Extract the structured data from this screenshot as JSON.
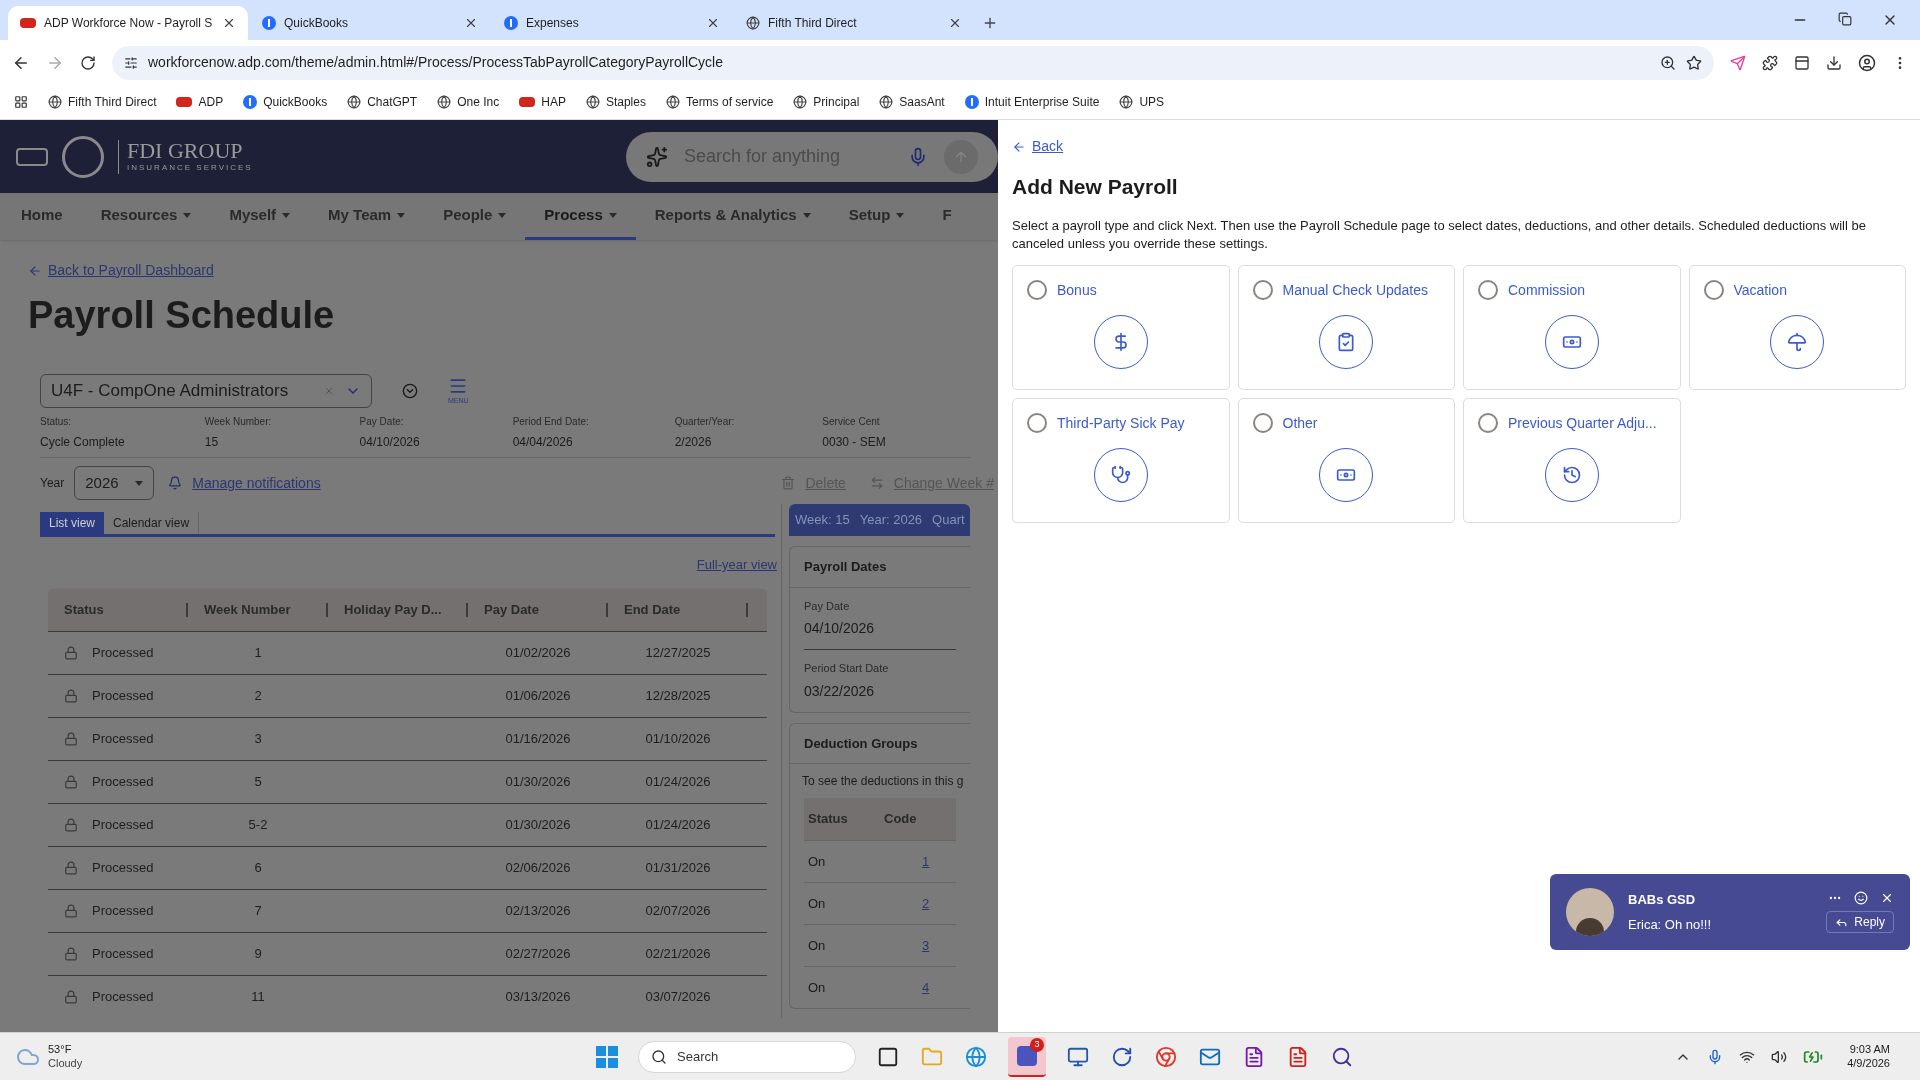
{
  "browser": {
    "tabs": [
      {
        "title": "ADP Workforce Now - Payroll S",
        "selected": true,
        "kind": "adp"
      },
      {
        "title": "QuickBooks",
        "selected": false,
        "kind": "intuit"
      },
      {
        "title": "Expenses",
        "selected": false,
        "kind": "intuit"
      },
      {
        "title": "Fifth Third Direct",
        "selected": false,
        "kind": "globe"
      }
    ],
    "url": "workforcenow.adp.com/theme/admin.html#/Process/ProcessTabPayrollCategoryPayrollCycle",
    "bookmarks": [
      {
        "label": "Fifth Third Direct",
        "kind": "globe"
      },
      {
        "label": "ADP",
        "kind": "adp"
      },
      {
        "label": "QuickBooks",
        "kind": "intuit"
      },
      {
        "label": "ChatGPT",
        "kind": "globe"
      },
      {
        "label": "One Inc",
        "kind": "globe"
      },
      {
        "label": "HAP",
        "kind": "adp"
      },
      {
        "label": "Staples",
        "kind": "globe"
      },
      {
        "label": "Terms of service",
        "kind": "globe"
      },
      {
        "label": "Principal",
        "kind": "globe"
      },
      {
        "label": "SaasAnt",
        "kind": "globe"
      },
      {
        "label": "Intuit Enterprise Suite",
        "kind": "intuit"
      },
      {
        "label": "UPS",
        "kind": "globe"
      }
    ]
  },
  "app": {
    "brand": {
      "name": "FDI GROUP",
      "tagline": "INSURANCE SERVICES"
    },
    "search": {
      "placeholder": "Search for anything"
    },
    "nav": [
      {
        "label": "Home",
        "selected": false,
        "dropdown": false
      },
      {
        "label": "Resources",
        "selected": false,
        "dropdown": true
      },
      {
        "label": "Myself",
        "selected": false,
        "dropdown": true
      },
      {
        "label": "My Team",
        "selected": false,
        "dropdown": true
      },
      {
        "label": "People",
        "selected": false,
        "dropdown": true
      },
      {
        "label": "Process",
        "selected": true,
        "dropdown": true
      },
      {
        "label": "Reports & Analytics",
        "selected": false,
        "dropdown": true
      },
      {
        "label": "Setup",
        "selected": false,
        "dropdown": true
      },
      {
        "label": "F",
        "selected": false,
        "dropdown": false
      }
    ],
    "back_link": "Back to Payroll Dashboard",
    "title": "Payroll Schedule",
    "company": "U4F - CompOne Administrators",
    "menu_label": "MENU",
    "summary": [
      {
        "label": "Status:",
        "value": "Cycle Complete"
      },
      {
        "label": "Week Number:",
        "value": "15"
      },
      {
        "label": "Pay Date:",
        "value": "04/10/2026"
      },
      {
        "label": "Period End Date:",
        "value": "04/04/2026"
      },
      {
        "label": "Quarter/Year:",
        "value": "2/2026"
      },
      {
        "label": "Service Cent",
        "value": "0030 - SEM"
      }
    ],
    "year_label": "Year",
    "year": "2026",
    "manage_notifications": "Manage notifications",
    "actions": [
      "Delete",
      "Change Week #"
    ],
    "views": [
      {
        "label": "List view",
        "selected": true
      },
      {
        "label": "Calendar view",
        "selected": false
      }
    ],
    "full_year_link": "Full-year view",
    "table": {
      "columns": [
        "Status",
        "Week Number",
        "Holiday Pay D...",
        "Pay Date",
        "End Date"
      ],
      "rows": [
        {
          "status": "Processed",
          "week": "1",
          "pay_date": "01/02/2026",
          "end_date": "12/27/2025"
        },
        {
          "status": "Processed",
          "week": "2",
          "pay_date": "01/06/2026",
          "end_date": "12/28/2025"
        },
        {
          "status": "Processed",
          "week": "3",
          "pay_date": "01/16/2026",
          "end_date": "01/10/2026"
        },
        {
          "status": "Processed",
          "week": "5",
          "pay_date": "01/30/2026",
          "end_date": "01/24/2026"
        },
        {
          "status": "Processed",
          "week": "5-2",
          "pay_date": "01/30/2026",
          "end_date": "01/24/2026"
        },
        {
          "status": "Processed",
          "week": "6",
          "pay_date": "02/06/2026",
          "end_date": "01/31/2026"
        },
        {
          "status": "Processed",
          "week": "7",
          "pay_date": "02/13/2026",
          "end_date": "02/07/2026"
        },
        {
          "status": "Processed",
          "week": "9",
          "pay_date": "02/27/2026",
          "end_date": "02/21/2026"
        },
        {
          "status": "Processed",
          "week": "11",
          "pay_date": "03/13/2026",
          "end_date": "03/07/2026"
        }
      ]
    },
    "week_bar": [
      "Week: 15",
      "Year: 2026",
      "Quart"
    ],
    "payroll_dates": {
      "title": "Payroll Dates",
      "fields": [
        {
          "label": "Pay Date",
          "value": "04/10/2026"
        },
        {
          "label": "Period Start Date",
          "value": "03/22/2026"
        }
      ]
    },
    "deduction_groups": {
      "title": "Deduction Groups",
      "description": "To see the deductions in this g",
      "columns": [
        "Status",
        "Code"
      ],
      "rows": [
        {
          "status": "On",
          "code": "1"
        },
        {
          "status": "On",
          "code": "2"
        },
        {
          "status": "On",
          "code": "3"
        },
        {
          "status": "On",
          "code": "4"
        }
      ]
    }
  },
  "panel": {
    "back": "Back",
    "title": "Add New Payroll",
    "description": "Select a payroll type and click Next. Then use the Payroll Schedule page to select dates, deductions, and other details. Scheduled deductions will be canceled unless you override these settings.",
    "options": [
      {
        "label": "Bonus",
        "selected": false
      },
      {
        "label": "Manual Check Updates",
        "selected": false
      },
      {
        "label": "Commission",
        "selected": false
      },
      {
        "label": "Vacation",
        "selected": false
      },
      {
        "label": "Third-Party Sick Pay",
        "selected": false
      },
      {
        "label": "Other",
        "selected": false
      },
      {
        "label": "Previous Quarter Adju...",
        "selected": false
      }
    ]
  },
  "toast": {
    "title": "BABs GSD",
    "message": "Erica: Oh no!!!",
    "reply": "Reply"
  },
  "taskbar": {
    "temperature": "53°F",
    "condition": "Cloudy",
    "search_placeholder": "Search",
    "teams_badge": "3",
    "time": "9:03 AM",
    "date": "4/9/2026"
  }
}
